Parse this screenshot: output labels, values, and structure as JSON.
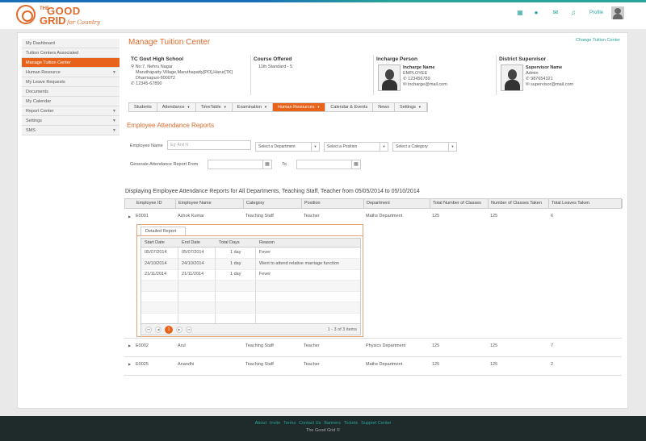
{
  "brand": {
    "the": "THE",
    "good": "GOOD",
    "grid": "GRID",
    "tagline": "for Country"
  },
  "topnav": {
    "profile": "Profile"
  },
  "sidebar": {
    "items": [
      {
        "label": "My Dashboard",
        "caret": false,
        "active": false
      },
      {
        "label": "Tuition Centers Associated",
        "caret": false,
        "active": false
      },
      {
        "label": "Manage Tuition Center",
        "caret": false,
        "active": true
      },
      {
        "label": "Human Resource",
        "caret": true,
        "active": false
      },
      {
        "label": "My Leave Requests",
        "caret": false,
        "active": false
      },
      {
        "label": "Documents",
        "caret": false,
        "active": false
      },
      {
        "label": "My Calendar",
        "caret": false,
        "active": false
      },
      {
        "label": "Report Center",
        "caret": true,
        "active": false
      },
      {
        "label": "Settings",
        "caret": true,
        "active": false
      },
      {
        "label": "SMS",
        "caret": true,
        "active": false
      }
    ]
  },
  "page": {
    "title": "Manage Tuition Center",
    "change_link": "Change Tuition Center"
  },
  "school": {
    "name": "TC Govt High School",
    "address1": "No:7, Nehru Nagar",
    "address2": "Maruthapatty Village,Maruthapatty[PO],Harur[TK]",
    "address3": "Dharmapuri-600072",
    "phone": "12345-67890"
  },
  "course": {
    "heading": "Course Offered",
    "value": "11th Standard - 5"
  },
  "incharge": {
    "heading": "Incharge Person",
    "name": "Incharge Name",
    "role": "EMPLOYEE",
    "phone": "123456789",
    "email": "incharge@mail.com"
  },
  "supervisor": {
    "heading": "District Supervisor",
    "name": "Supervisor Name",
    "role": "Admin",
    "phone": "987654321",
    "email": "supervisor@mail.com"
  },
  "tabs": [
    {
      "label": "Students",
      "caret": false,
      "active": false
    },
    {
      "label": "Attendance",
      "caret": true,
      "active": false
    },
    {
      "label": "TimeTable",
      "caret": true,
      "active": false
    },
    {
      "label": "Examination",
      "caret": true,
      "active": false
    },
    {
      "label": "Human Resources",
      "caret": true,
      "active": true
    },
    {
      "label": "Calendar & Events",
      "caret": false,
      "active": false
    },
    {
      "label": "News",
      "caret": false,
      "active": false
    },
    {
      "label": "Settings",
      "caret": true,
      "active": false
    }
  ],
  "section": {
    "title": "Employee Attendance Reports"
  },
  "filters": {
    "employee_name_label": "Employee Name",
    "employee_name_placeholder": "Eg: Anil N",
    "department": "Select a Department",
    "position": "Select a Position",
    "category": "Select a Category",
    "report_from_label": "Generate Attendance Report From",
    "to_label": "To",
    "from_value": "",
    "to_value": ""
  },
  "display_text": "Displaying Employee Attendance Reports  for All Departments, Teaching Staff, Teacher from 05/05/2014 to 05/10/2014",
  "grid": {
    "headers": [
      "Employee ID",
      "Employee Name",
      "Category",
      "Position",
      "Department",
      "Total Number of Classes",
      "Number of Classes Taken",
      "Total Leaves Taken"
    ],
    "rows": [
      {
        "id": "E0001",
        "name": "Ashok Kumar",
        "category": "Teaching Staff",
        "position": "Teacher",
        "department": "Maths Department",
        "total_classes": "125",
        "classes_taken": "125",
        "leaves": "6"
      },
      {
        "id": "E0002",
        "name": "Arul",
        "category": "Teaching Staff",
        "position": "Teacher",
        "department": "Physics Department",
        "total_classes": "125",
        "classes_taken": "125",
        "leaves": "7"
      },
      {
        "id": "E0025",
        "name": "Anandhi",
        "category": "Teaching Staff",
        "position": "Teacher",
        "department": "Maths Department",
        "total_classes": "125",
        "classes_taken": "125",
        "leaves": "2"
      }
    ]
  },
  "detail": {
    "tab": "Detailed Report",
    "headers": [
      "Start Date",
      "End Date",
      "Total Days",
      "Reason"
    ],
    "rows": [
      {
        "start": "05/07/2014",
        "end": "05/07/2014",
        "days": "1 day",
        "reason": "Fever"
      },
      {
        "start": "24/10/2014",
        "end": "24/10/2014",
        "days": "1 day",
        "reason": "Went to attend relative marriage function"
      },
      {
        "start": "21/11/2014",
        "end": "21/11/2014",
        "days": "1 day",
        "reason": "Fever"
      }
    ],
    "pager": {
      "current": "1",
      "info": "1 - 3 of 3 items"
    }
  },
  "footer": {
    "links": [
      "About",
      "Invite",
      "Terms",
      "Contact Us",
      "Banners",
      "Tickets",
      "Support Center"
    ],
    "copyright": "The Good Grid ©"
  },
  "icons": {
    "grid": "grid-icon",
    "users": "users-icon",
    "mail": "mail-icon",
    "bell": "bell-icon",
    "accent": "#e8621a",
    "teal": "#2aa39a"
  }
}
